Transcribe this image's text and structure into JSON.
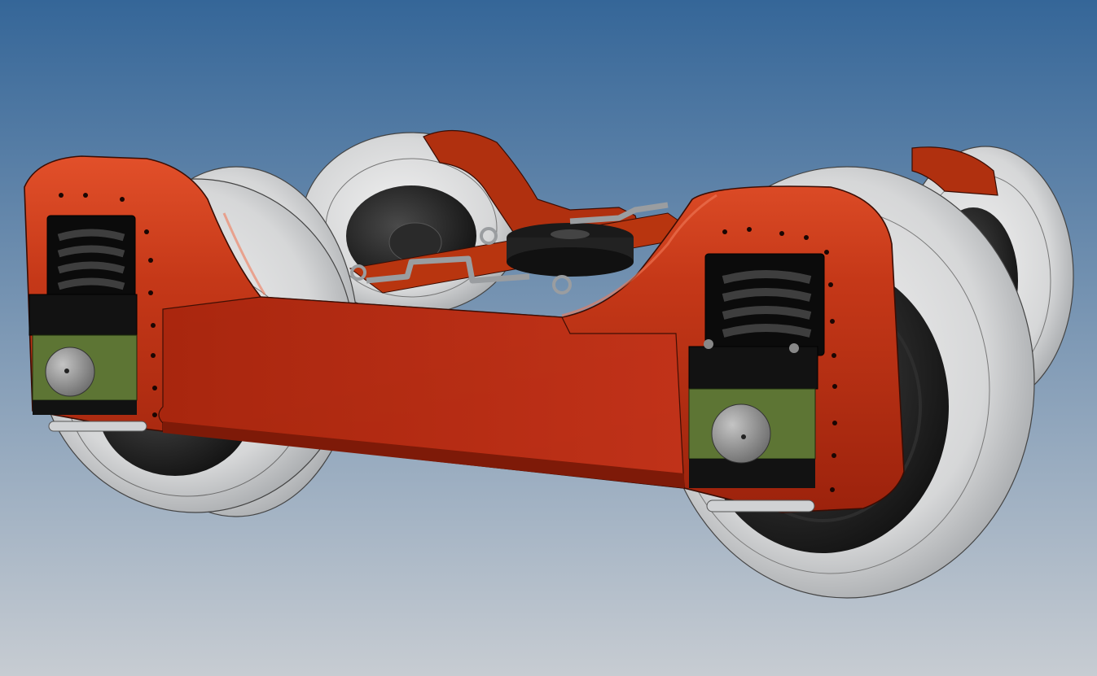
{
  "viewport": {
    "background_top": "#356698",
    "background_bottom": "#c7ccd2"
  },
  "model": {
    "subject": "railway-bogie-assembly",
    "components": [
      "side-frame-front",
      "side-frame-rear",
      "bolster",
      "center-pivot-plate",
      "brake-rigging",
      "wheelset-front-left",
      "wheelset-front-right",
      "wheelset-rear-left",
      "wheelset-rear-right",
      "primary-spring-left",
      "primary-spring-right",
      "axle-box-left",
      "axle-box-right"
    ],
    "colors": {
      "frame": "#b02a12",
      "frame_highlight": "#e2502a",
      "frame_shadow": "#7e1a08",
      "wheel_tread": "#d9dadb",
      "wheel_shadow": "#9ea2a6",
      "wheel_hub": "#1c1c1c",
      "spring": "#1e1e1e",
      "axle_box": "#5d7534",
      "axle_box_dark": "#121212",
      "cover": "#8e8e8e",
      "linkage": "#b9bcbf"
    }
  }
}
